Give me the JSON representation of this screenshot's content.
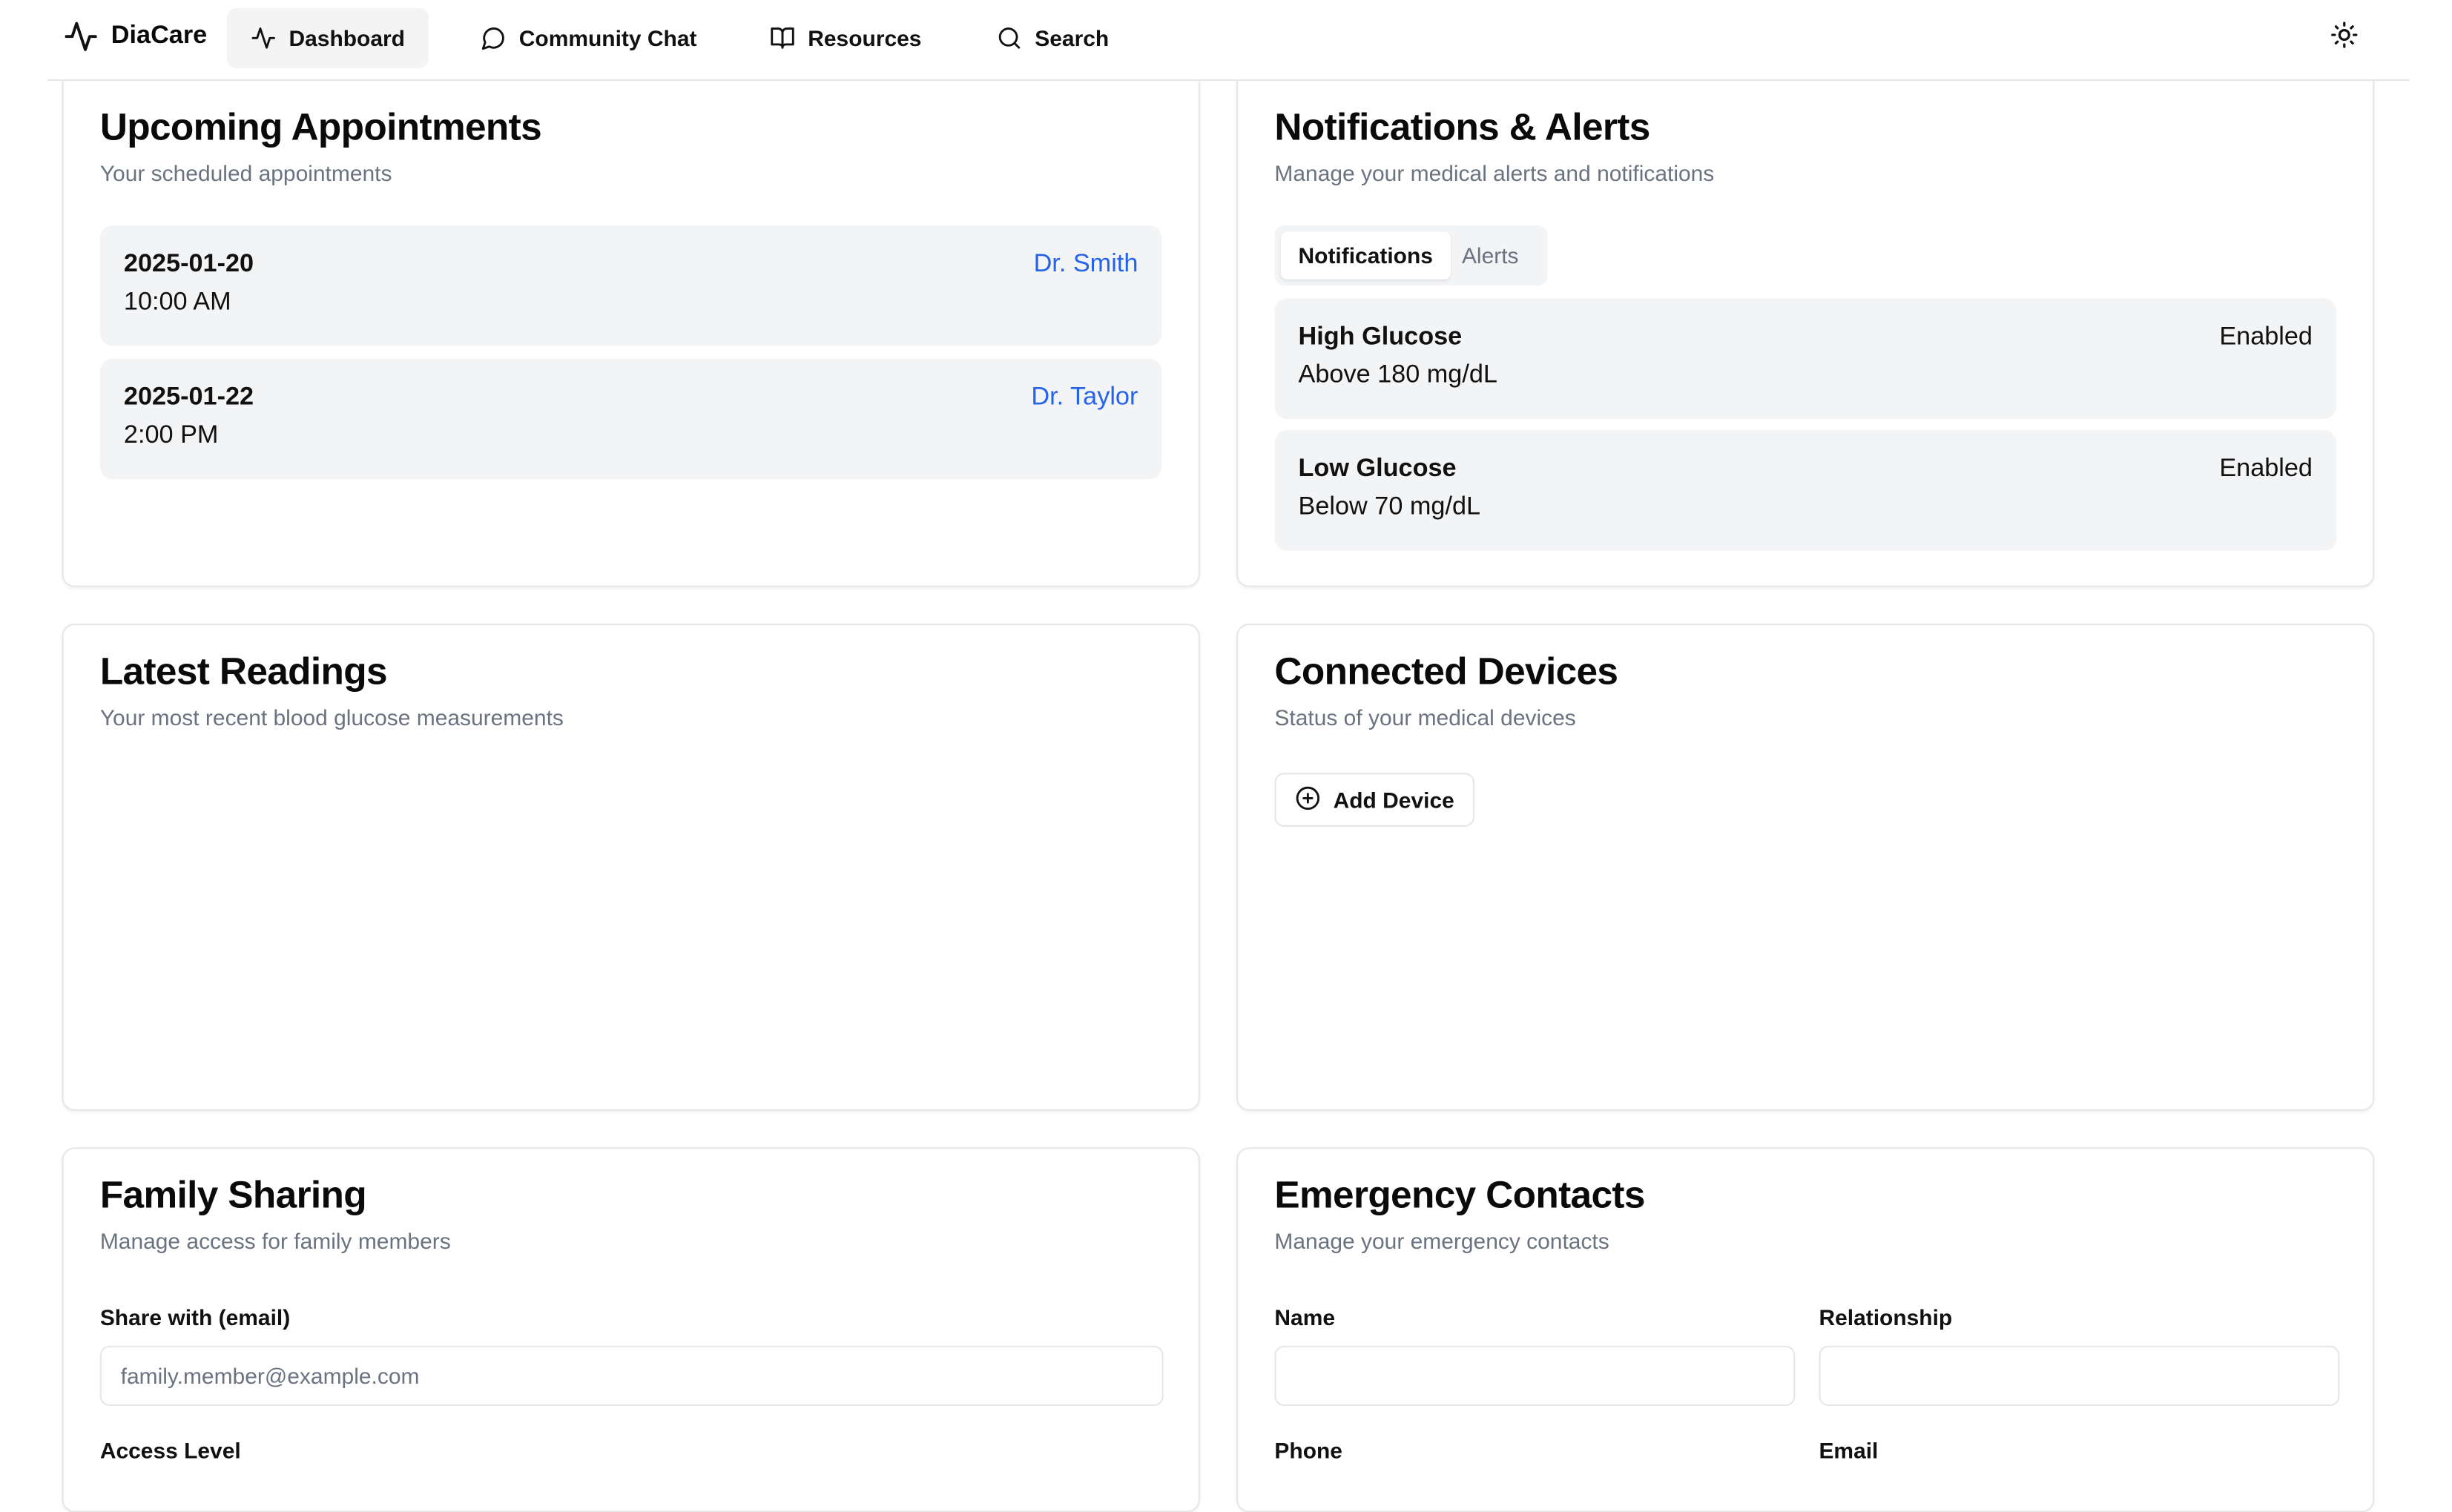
{
  "app": {
    "name": "DiaCare"
  },
  "nav": {
    "items": [
      {
        "label": "Dashboard",
        "icon": "activity-icon",
        "active": true
      },
      {
        "label": "Community Chat",
        "icon": "message-circle-icon",
        "active": false
      },
      {
        "label": "Resources",
        "icon": "book-open-icon",
        "active": false
      },
      {
        "label": "Search",
        "icon": "search-icon",
        "active": false
      }
    ],
    "theme_icon": "sun-icon"
  },
  "appointments": {
    "title": "Upcoming Appointments",
    "description": "Your scheduled appointments",
    "items": [
      {
        "date": "2025-01-20",
        "time": "10:00 AM",
        "doctor": "Dr. Smith"
      },
      {
        "date": "2025-01-22",
        "time": "2:00 PM",
        "doctor": "Dr. Taylor"
      }
    ]
  },
  "notifications": {
    "title": "Notifications & Alerts",
    "description": "Manage your medical alerts and notifications",
    "tabs": [
      {
        "label": "Notifications",
        "active": true
      },
      {
        "label": "Alerts",
        "active": false
      }
    ],
    "items": [
      {
        "name": "High Glucose",
        "condition": "Above 180 mg/dL",
        "status": "Enabled"
      },
      {
        "name": "Low Glucose",
        "condition": "Below 70 mg/dL",
        "status": "Enabled"
      }
    ]
  },
  "readings": {
    "title": "Latest Readings",
    "description": "Your most recent blood glucose measurements"
  },
  "devices": {
    "title": "Connected Devices",
    "description": "Status of your medical devices",
    "add_label": "Add Device"
  },
  "family": {
    "title": "Family Sharing",
    "description": "Manage access for family members",
    "share_label": "Share with (email)",
    "share_placeholder": "family.member@example.com",
    "access_label": "Access Level"
  },
  "emergency": {
    "title": "Emergency Contacts",
    "description": "Manage your emergency contacts",
    "name_label": "Name",
    "relationship_label": "Relationship",
    "phone_label": "Phone",
    "email_label": "Email"
  },
  "colors": {
    "accent_link": "#2563eb",
    "muted_text": "#6b7280",
    "item_bg": "#f3f4f6",
    "border": "#e5e7eb"
  }
}
